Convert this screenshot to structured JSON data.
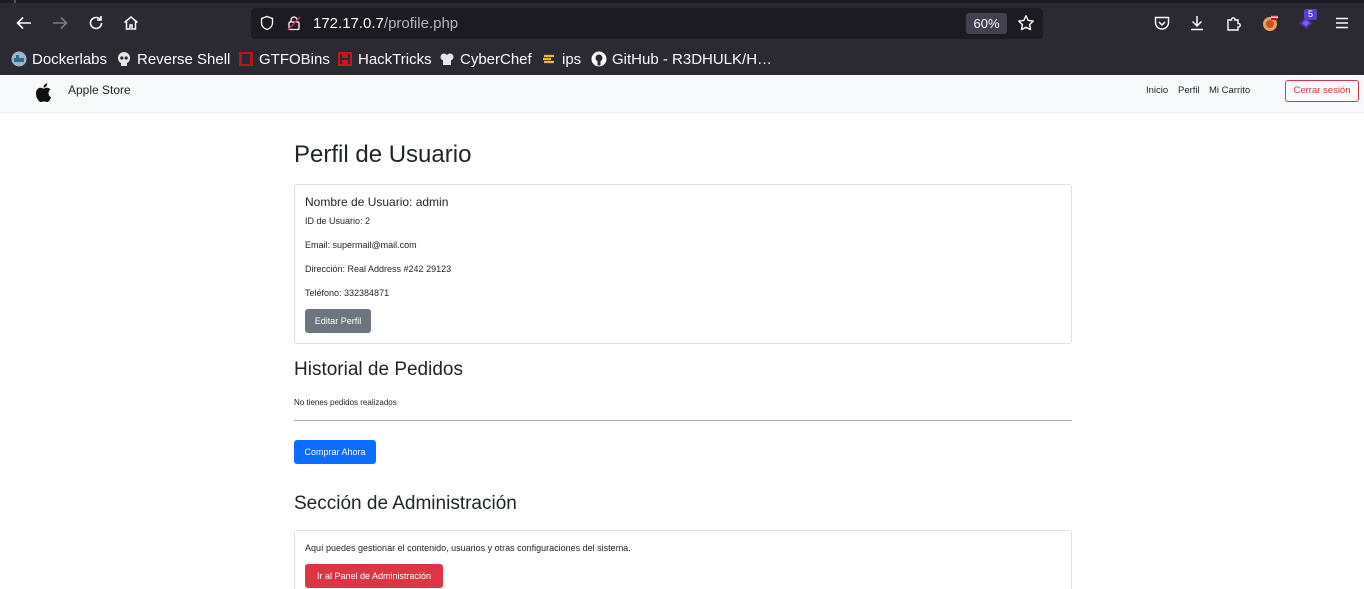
{
  "browser": {
    "url_host": "172.17.0.7",
    "url_path": "/profile.php",
    "zoom": "60%",
    "extension_badge": "5",
    "bookmarks": [
      {
        "label": "Dockerlabs",
        "icon": "docker-icon"
      },
      {
        "label": "Reverse Shell",
        "icon": "skull-icon"
      },
      {
        "label": "GTFOBins",
        "icon": "gtfobins-icon"
      },
      {
        "label": "HackTricks",
        "icon": "hacktricks-icon"
      },
      {
        "label": "CyberChef",
        "icon": "chef-icon"
      },
      {
        "label": "ips",
        "icon": "ips-icon"
      },
      {
        "label": "GitHub - R3DHULK/H…",
        "icon": "github-icon"
      }
    ]
  },
  "navbar": {
    "brand": "Apple Store",
    "links": [
      "Inicio",
      "Perfil",
      "Mi Carrito"
    ],
    "logout": "Cerrar sesión"
  },
  "profile": {
    "title": "Perfil de Usuario",
    "username_line": "Nombre de Usuario: admin",
    "id_line": "ID de Usuario: 2",
    "email_line": "Email: supermail@mail.com",
    "address_line": "Dirección: Real Address #242 29123",
    "phone_line": "Teléfono: 332384871",
    "edit_button": "Editar Perfil"
  },
  "orders": {
    "title": "Historial de Pedidos",
    "empty_text": "No tienes pedidos realizados",
    "buy_button": "Comprar Ahora"
  },
  "admin": {
    "title": "Sección de Administración",
    "description": "Aquí puedes gestionar el contenido, usuarios y otras configuraciones del sistema.",
    "panel_button": "Ir al Panel de Administración"
  },
  "colors": {
    "primary": "#0d6efd",
    "secondary": "#6c757d",
    "danger": "#dc3545"
  }
}
